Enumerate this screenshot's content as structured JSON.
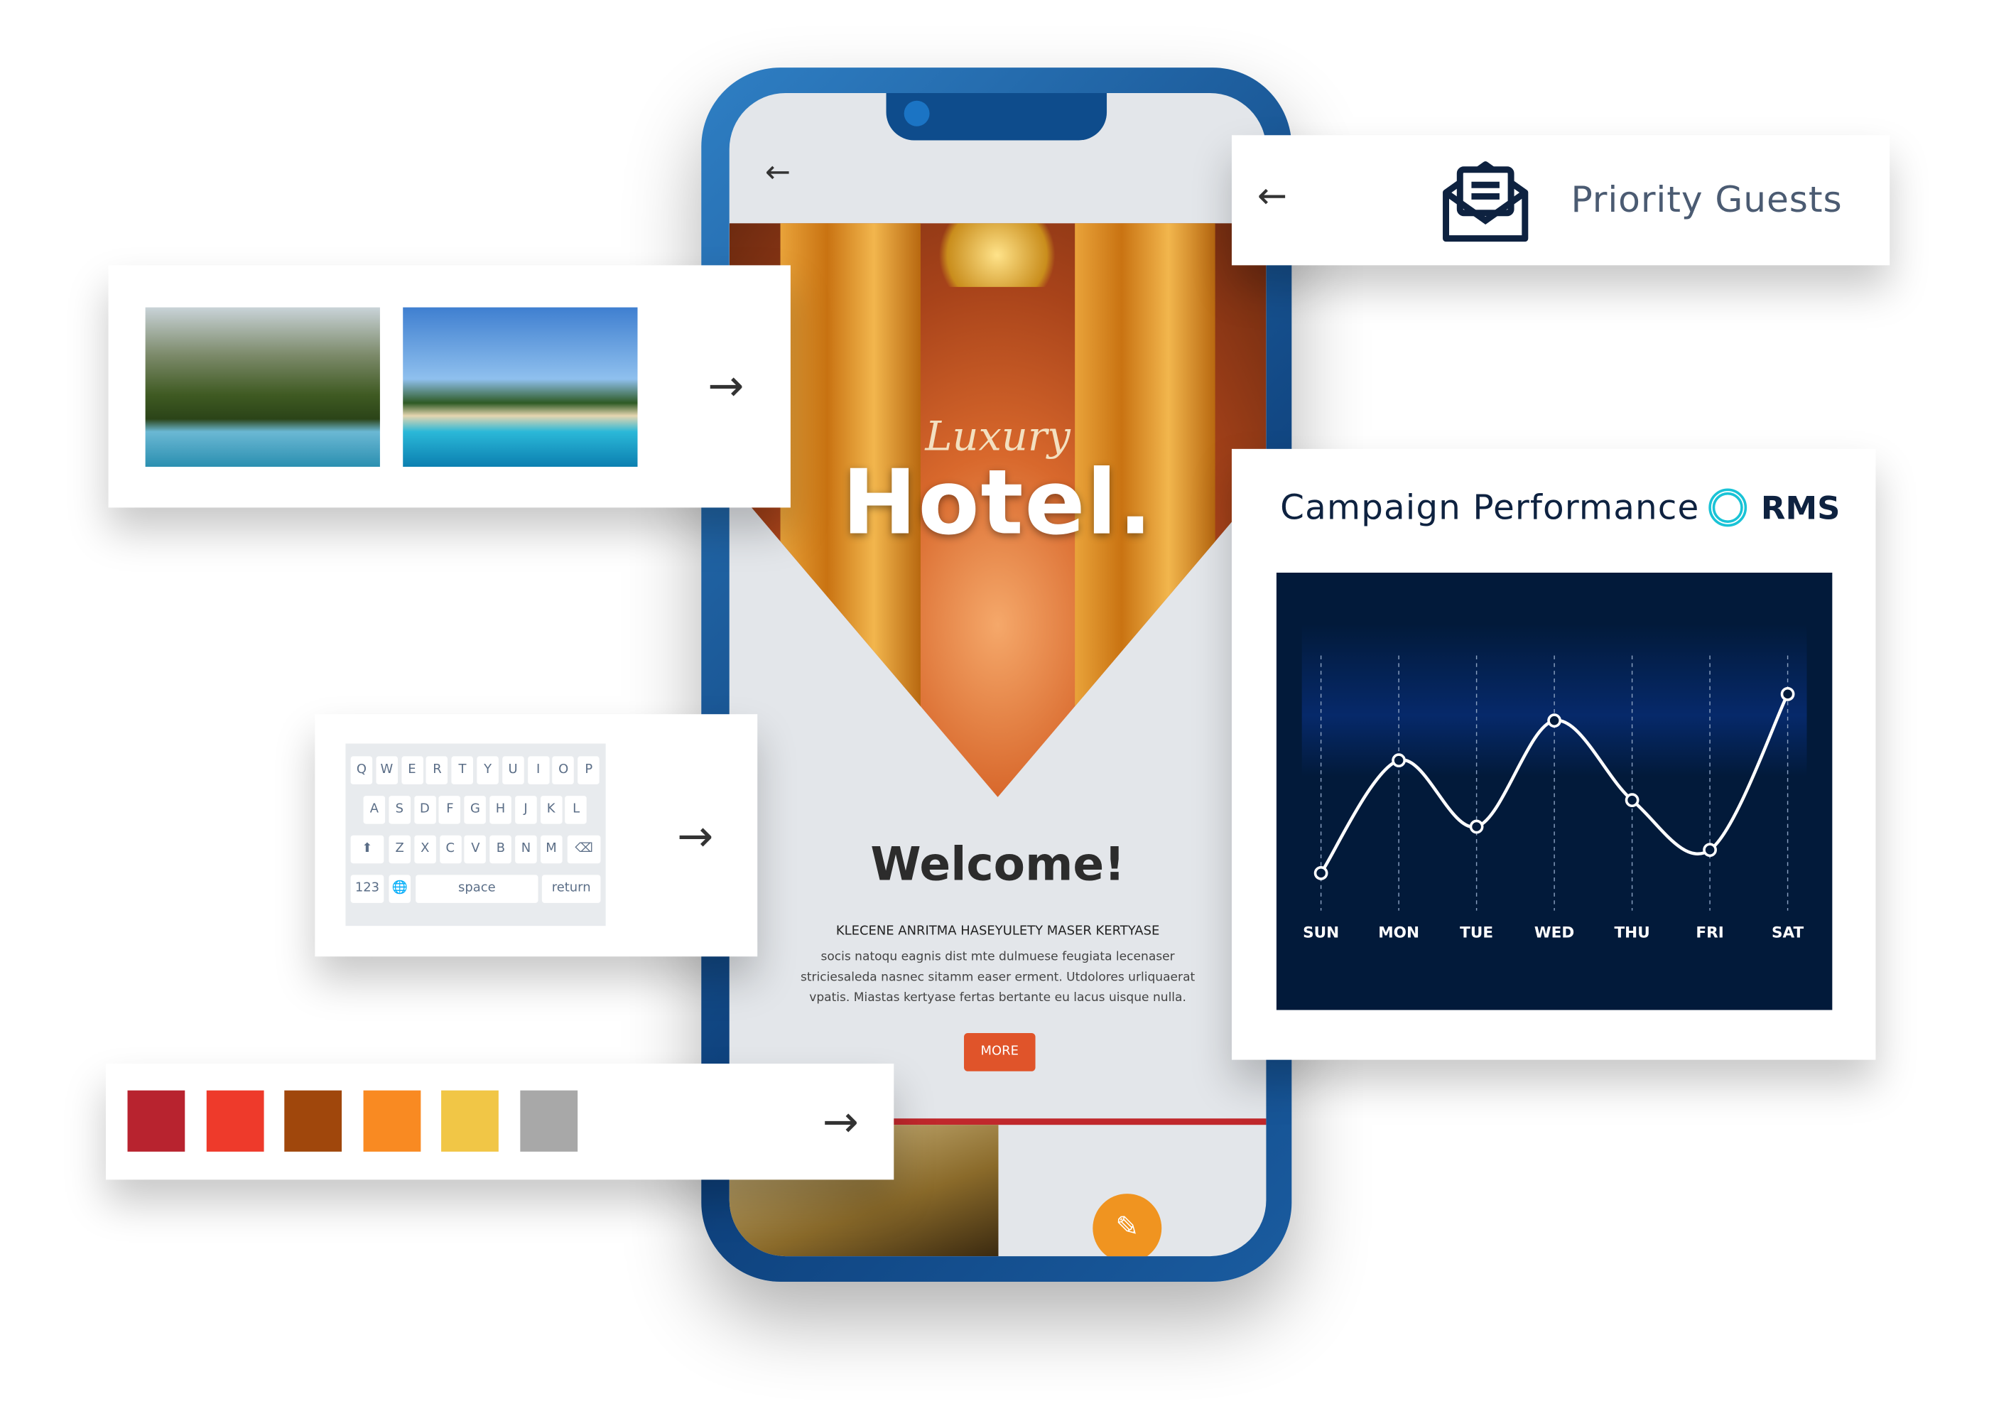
{
  "phone": {
    "back_icon": "arrow-left-icon",
    "hero_script": "Luxury",
    "hero_title": "Hotel.",
    "welcome": "Welcome!",
    "subheading": "KLECENE ANRITMA HASEYULETY MASER KERTYASE",
    "body": "socis natoqu eagnis dist mte dulmuese feugiata lecenaser striciesaleda nasnec sitamm easer erment. Utdolores urliquaerat vpatis. Miastas kertyase fertas bertante eu lacus uisque nulla.",
    "more_label": "MORE",
    "fab_icon": "pencil-icon",
    "accent": "#e0542a"
  },
  "image_card": {
    "arrow_icon": "arrow-right-icon"
  },
  "priority_card": {
    "back_icon": "arrow-left-icon",
    "icon": "envelope-open-icon",
    "title": "Priority Guests"
  },
  "campaign_card": {
    "title": "Campaign Performance",
    "logo_text": "RMS",
    "logo_color": "#19c3d6"
  },
  "keyboard_card": {
    "rows": [
      [
        "Q",
        "W",
        "E",
        "R",
        "T",
        "Y",
        "U",
        "I",
        "O",
        "P"
      ],
      [
        "A",
        "S",
        "D",
        "F",
        "G",
        "H",
        "J",
        "K",
        "L"
      ],
      [
        "Z",
        "X",
        "C",
        "V",
        "B",
        "N",
        "M"
      ]
    ],
    "num_label": "123",
    "space_label": "space",
    "return_label": "return",
    "arrow_icon": "arrow-right-icon"
  },
  "palette_card": {
    "colors": [
      "#b8232f",
      "#ee3a2b",
      "#a0470c",
      "#f98a22",
      "#f1c646",
      "#a8a8a8"
    ],
    "arrow_icon": "arrow-right-icon"
  },
  "chart_data": {
    "type": "line",
    "categories": [
      "SUN",
      "MON",
      "TUE",
      "WED",
      "THU",
      "FRI",
      "SAT"
    ],
    "values": [
      29,
      63,
      43,
      75,
      51,
      36,
      83
    ],
    "ylim": [
      0,
      100
    ],
    "grid": "vertical dashed",
    "background": "#021a3a",
    "line_color": "#ffffff"
  }
}
